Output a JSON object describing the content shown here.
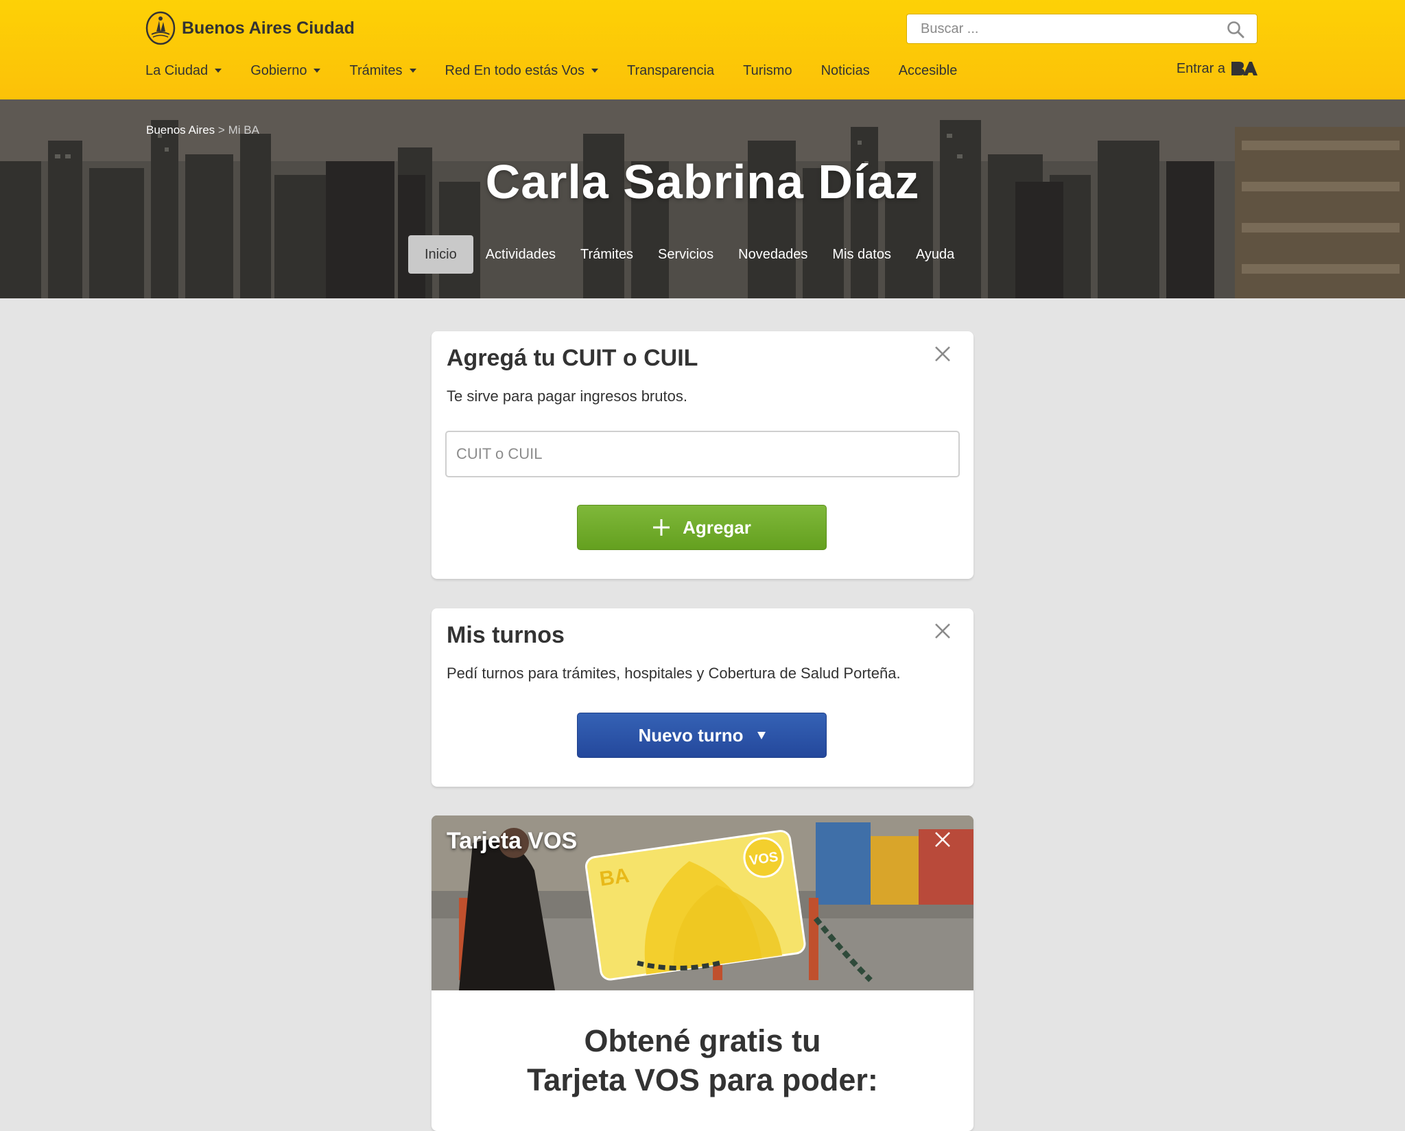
{
  "header": {
    "brand_name": "Buenos Aires Ciudad",
    "search_placeholder": "Buscar ...",
    "nav": [
      {
        "label": "La Ciudad",
        "dropdown": true
      },
      {
        "label": "Gobierno",
        "dropdown": true
      },
      {
        "label": "Trámites",
        "dropdown": true
      },
      {
        "label": "Red En todo estás Vos",
        "dropdown": true
      },
      {
        "label": "Transparencia",
        "dropdown": false
      },
      {
        "label": "Turismo",
        "dropdown": false
      },
      {
        "label": "Noticias",
        "dropdown": false
      },
      {
        "label": "Accesible",
        "dropdown": false
      }
    ],
    "login_label": "Entrar a",
    "login_logo": "BA",
    "colors": {
      "bar": "#fcc108",
      "text": "#333333"
    }
  },
  "hero": {
    "breadcrumb": {
      "home": "Buenos Aires",
      "separator": ">",
      "current": "Mi BA"
    },
    "title": "Carla Sabrina Díaz",
    "tabs": [
      "Inicio",
      "Actividades",
      "Trámites",
      "Servicios",
      "Novedades",
      "Mis datos",
      "Ayuda"
    ],
    "active_tab": "Inicio"
  },
  "cards": {
    "cuit": {
      "title": "Agregá tu CUIT o CUIL",
      "text": "Te sirve para pagar ingresos brutos.",
      "input_placeholder": "CUIT o CUIL",
      "button_label": "Agregar",
      "button_color": "#6aa626"
    },
    "turnos": {
      "title": "Mis turnos",
      "text": "Pedí turnos para trámites, hospitales y Cobertura de Salud Porteña.",
      "button_label": "Nuevo turno",
      "button_color": "#2a51a6"
    },
    "vos": {
      "title": "Tarjeta VOS",
      "card_logo": "BA",
      "card_badge": "VOS",
      "heading_line1": "Obtené gratis tu",
      "heading_line2": "Tarjeta VOS para poder:"
    }
  }
}
